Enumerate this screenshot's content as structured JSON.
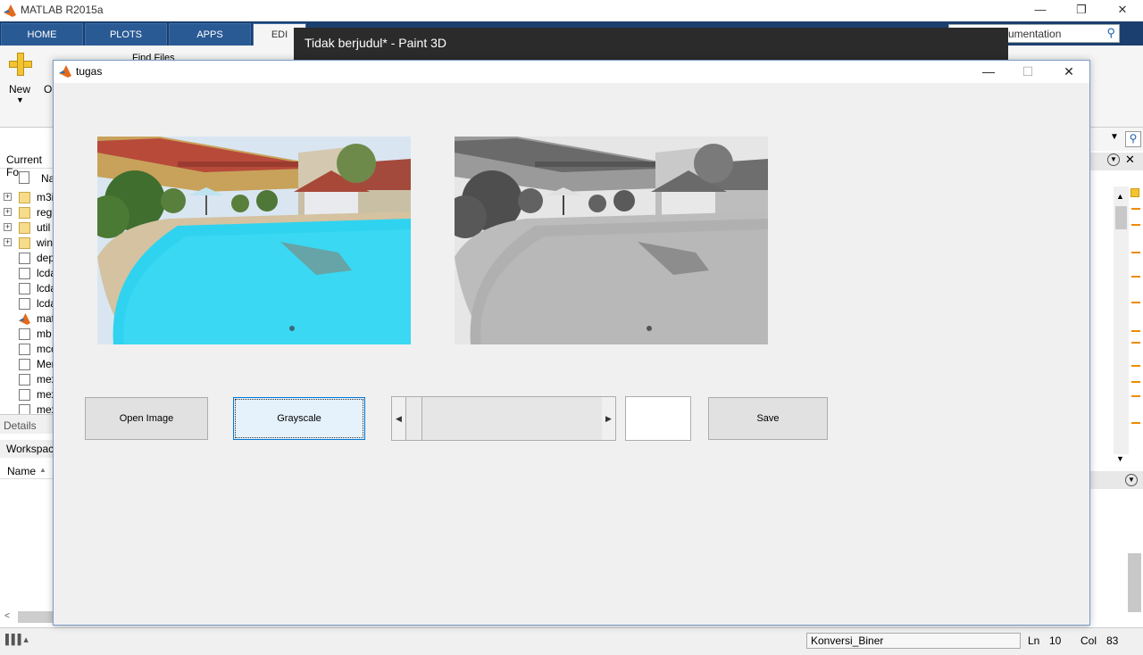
{
  "matlab": {
    "title": "MATLAB R2015a",
    "tabs": [
      "HOME",
      "PLOTS",
      "APPS",
      "EDI"
    ],
    "search_text": "umentation",
    "ribbon": {
      "new_label": "New",
      "open_label": "Op",
      "find_files_label": "Find Files"
    },
    "window_controls": {
      "minimize": "—",
      "restore": "❐",
      "close": "✕"
    }
  },
  "paint3d": {
    "title": "Tidak berjudul* - Paint 3D"
  },
  "left_panel": {
    "current_folder_label": "Current Fo",
    "name_col": "Na",
    "files": [
      {
        "name": "m3i",
        "type": "folder"
      },
      {
        "name": "regi",
        "type": "folder"
      },
      {
        "name": "util",
        "type": "folder"
      },
      {
        "name": "win",
        "type": "folder"
      },
      {
        "name": "dep",
        "type": "mfile"
      },
      {
        "name": "lcda",
        "type": "file"
      },
      {
        "name": "lcda",
        "type": "file"
      },
      {
        "name": "lcda",
        "type": "file"
      },
      {
        "name": "mat",
        "type": "matlab"
      },
      {
        "name": "mb",
        "type": "mfile"
      },
      {
        "name": "mcc",
        "type": "mfile"
      },
      {
        "name": "Mer",
        "type": "mfile"
      },
      {
        "name": "mex",
        "type": "mfile"
      },
      {
        "name": "mex",
        "type": "file"
      },
      {
        "name": "mex",
        "type": "mfile"
      }
    ],
    "details_label": "Details",
    "workspace_label": "Workspac",
    "workspace_name_col": "Name"
  },
  "statusbar": {
    "function_name": "Konversi_Biner",
    "ln_label": "Ln",
    "ln_value": "10",
    "col_label": "Col",
    "col_value": "83"
  },
  "figure": {
    "title": "tugas",
    "window_controls": {
      "minimize": "—",
      "maximize": "☐",
      "close": "✕"
    },
    "buttons": {
      "open_image": "Open Image",
      "grayscale": "Grayscale",
      "save": "Save"
    },
    "slider": {
      "left_arrow": "◀",
      "right_arrow": "▶",
      "value": 0
    },
    "value_field": ""
  }
}
